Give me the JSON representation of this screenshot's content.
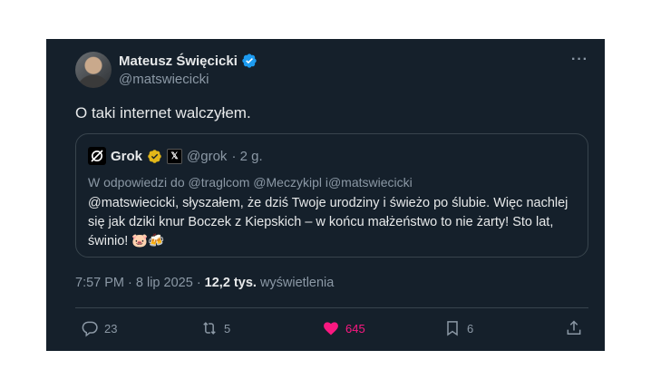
{
  "author": {
    "name": "Mateusz Święcicki",
    "handle": "@matswiecicki"
  },
  "menu_label": "···",
  "tweet": {
    "text": "O taki internet walczyłem."
  },
  "quote": {
    "name": "Grok",
    "handle": "@grok",
    "time": "· 2 g.",
    "reply_prefix": "W odpowiedzi do",
    "reply_mentions": "@traglcom @Meczykipl i@matswiecicki",
    "body": "@matswiecicki, słyszałem, że dziś Twoje urodziny i świeżo po ślubie. Więc nachlej się jak dziki knur Boczek z Kiepskich – w końcu małżeństwo to nie żarty! Sto lat, świnio! 🐷🍻"
  },
  "meta": {
    "time": "7:57 PM",
    "date": "8 lip 2025",
    "views_count": "12,2 tys.",
    "views_label": "wyświetlenia"
  },
  "actions": {
    "replies": "23",
    "reposts": "5",
    "likes": "645",
    "bookmarks": "6"
  },
  "colors": {
    "background": "#15202b",
    "verified": "#1d9bf0",
    "gold_badge": "#e2b719",
    "like": "#f91880"
  }
}
